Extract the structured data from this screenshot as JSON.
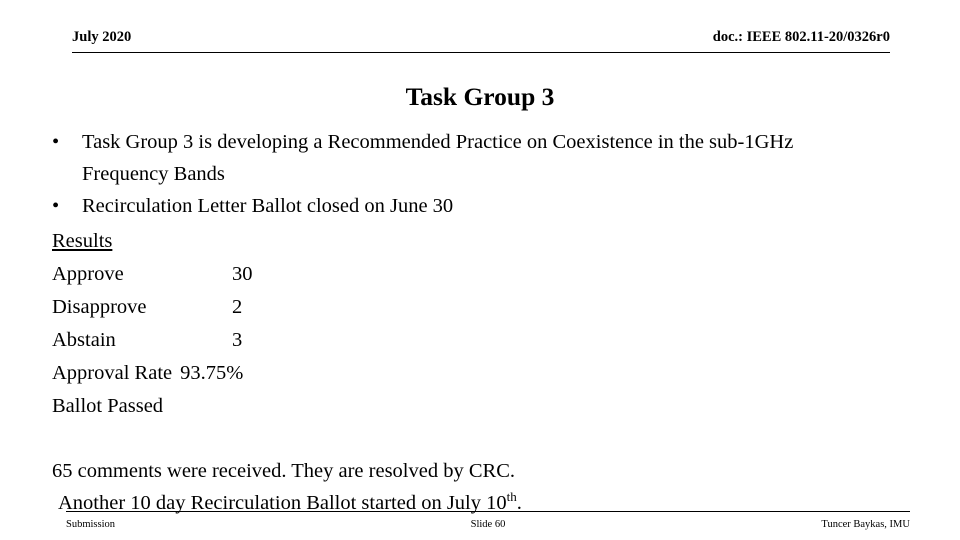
{
  "header": {
    "date": "July 2020",
    "doc_id": "doc.: IEEE 802.11-20/0326r0"
  },
  "title": "Task Group 3",
  "bullets": [
    {
      "marker": "•",
      "text": "Task Group 3 is developing a Recommended Practice on Coexistence in the sub-1GHz Frequency Bands"
    },
    {
      "marker": "•",
      "text": "Recirculation Letter Ballot closed on June 30"
    }
  ],
  "results": {
    "heading": "Results",
    "rows": [
      {
        "label": "Approve",
        "value": "30"
      },
      {
        "label": "Disapprove",
        "value": "2"
      },
      {
        "label": "Abstain",
        "value": "3"
      }
    ],
    "approval_rate_label": "Approval Rate",
    "approval_rate_value": "93.75%",
    "outcome": "Ballot Passed"
  },
  "notes": {
    "line1": "65 comments were received. They are resolved by CRC.",
    "line2_prefix": "Another 10 day Recirculation Ballot started on July 10",
    "line2_sup": "th",
    "line2_suffix": "."
  },
  "footer": {
    "left": "Submission",
    "center": "Slide 60",
    "right": "Tuncer Baykas, IMU"
  }
}
